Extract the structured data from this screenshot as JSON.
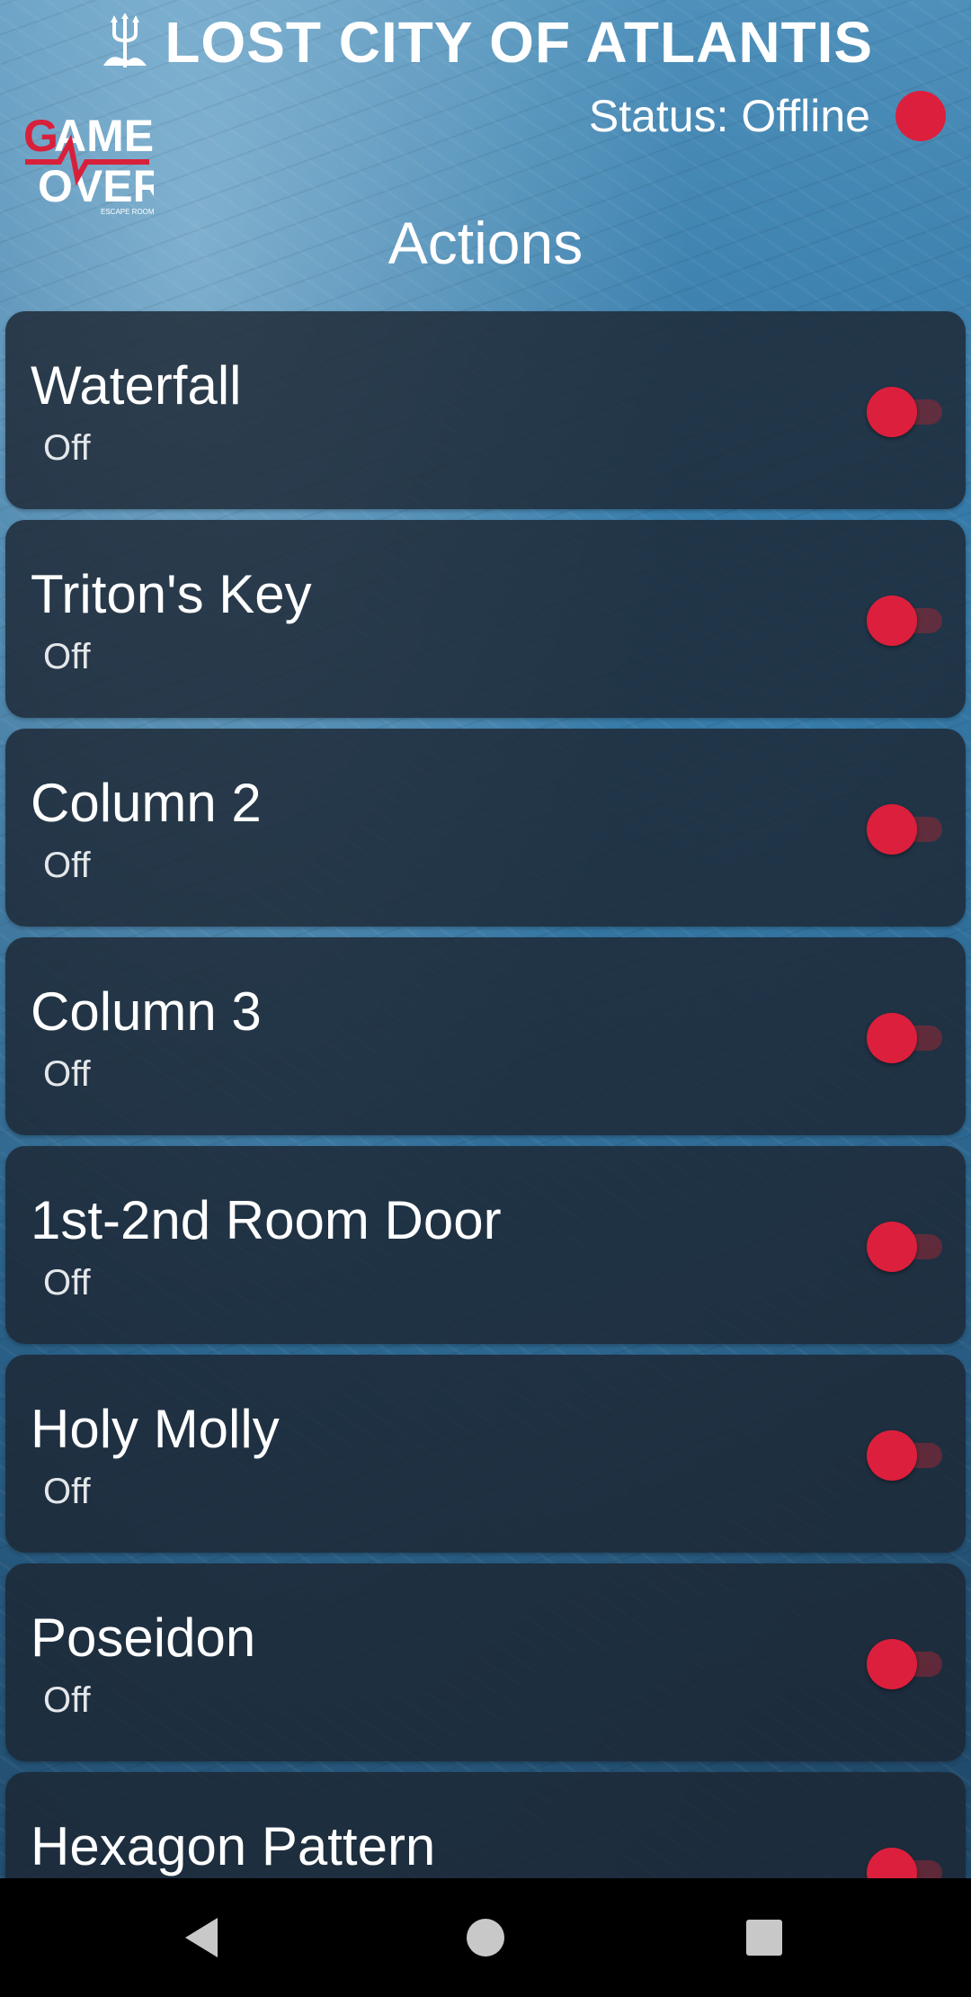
{
  "header": {
    "app_title": "LOST CITY OF ATLANTIS",
    "status_text": "Status: Offline",
    "status_color": "#dc1f3c",
    "logo_text": "GAME OVER ESCAPE ROOMS"
  },
  "section_title": "Actions",
  "actions": [
    {
      "label": "Waterfall",
      "state": "Off"
    },
    {
      "label": "Triton's Key",
      "state": "Off"
    },
    {
      "label": "Column 2",
      "state": "Off"
    },
    {
      "label": "Column 3",
      "state": "Off"
    },
    {
      "label": "1st-2nd Room Door",
      "state": "Off"
    },
    {
      "label": "Holy Molly",
      "state": "Off"
    },
    {
      "label": "Poseidon",
      "state": "Off"
    },
    {
      "label": "Hexagon Pattern",
      "state": ""
    }
  ],
  "colors": {
    "accent": "#dc1f3c",
    "card_bg": "#1c2632",
    "text": "#ffffff"
  },
  "icons": {
    "title_icon": "trident-icon",
    "nav_back": "back-triangle-icon",
    "nav_home": "home-circle-icon",
    "nav_recents": "recents-square-icon"
  }
}
